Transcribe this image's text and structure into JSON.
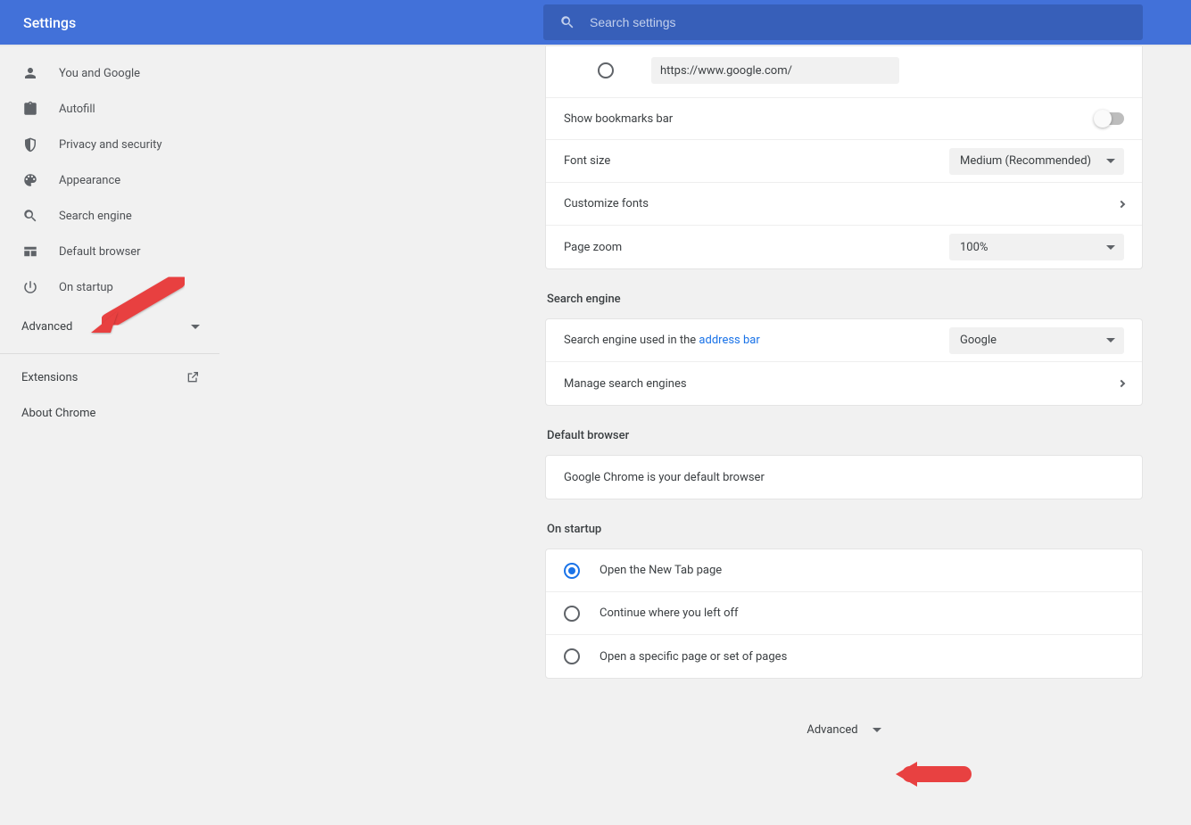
{
  "header": {
    "title": "Settings",
    "search_placeholder": "Search settings"
  },
  "sidebar": {
    "items": [
      {
        "label": "You and Google",
        "icon": "person-icon"
      },
      {
        "label": "Autofill",
        "icon": "clipboard-icon"
      },
      {
        "label": "Privacy and security",
        "icon": "shield-icon"
      },
      {
        "label": "Appearance",
        "icon": "palette-icon"
      },
      {
        "label": "Search engine",
        "icon": "search-icon"
      },
      {
        "label": "Default browser",
        "icon": "browser-icon"
      },
      {
        "label": "On startup",
        "icon": "power-icon"
      }
    ],
    "advanced_label": "Advanced",
    "extensions_label": "Extensions",
    "about_label": "About Chrome"
  },
  "appearance_card": {
    "url_value": "https://www.google.com/",
    "bookmarks_label": "Show bookmarks bar",
    "bookmarks_on": false,
    "font_size_label": "Font size",
    "font_size_value": "Medium (Recommended)",
    "customize_fonts_label": "Customize fonts",
    "page_zoom_label": "Page zoom",
    "page_zoom_value": "100%"
  },
  "search_engine": {
    "title": "Search engine",
    "used_label_pre": "Search engine used in the ",
    "used_label_link": "address bar",
    "value": "Google",
    "manage_label": "Manage search engines"
  },
  "default_browser": {
    "title": "Default browser",
    "text": "Google Chrome is your default browser"
  },
  "on_startup": {
    "title": "On startup",
    "options": [
      "Open the New Tab page",
      "Continue where you left off",
      "Open a specific page or set of pages"
    ],
    "selected": 0
  },
  "footer": {
    "advanced_label": "Advanced"
  }
}
